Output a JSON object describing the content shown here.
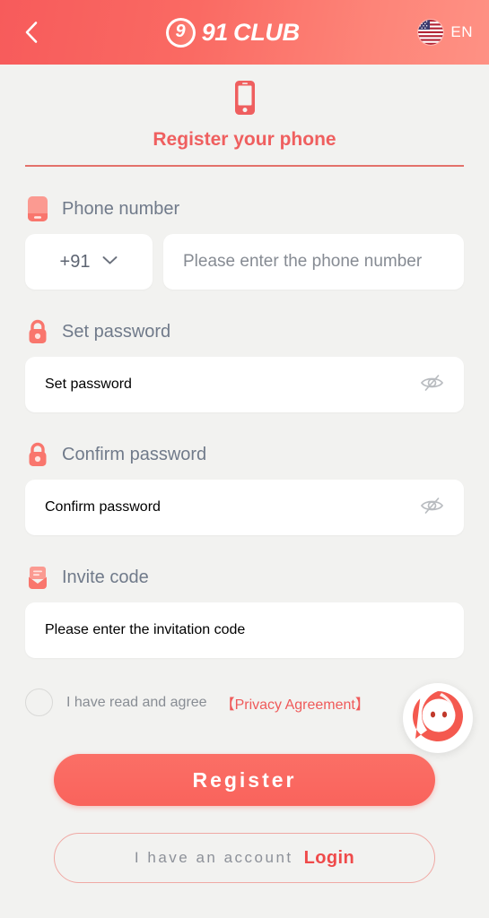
{
  "header": {
    "back_icon": "chevron-left-icon",
    "brand_mark_char": "9",
    "brand_name": "91",
    "brand_suffix": "CLUB",
    "flag_icon": "us-flag-icon",
    "language": "EN"
  },
  "title_section": {
    "icon": "mobile-phone-icon",
    "title": "Register your phone"
  },
  "form": {
    "phone": {
      "icon": "phone-icon",
      "label": "Phone number",
      "country_code": "+91",
      "dropdown_icon": "chevron-down-icon",
      "placeholder": "Please enter the phone number"
    },
    "password": {
      "icon": "lock-icon",
      "label": "Set password",
      "placeholder": "Set password",
      "toggle_icon": "eye-off-icon"
    },
    "confirm_password": {
      "icon": "lock-icon",
      "label": "Confirm password",
      "placeholder": "Confirm password",
      "toggle_icon": "eye-off-icon"
    },
    "invite": {
      "icon": "envelope-icon",
      "label": "Invite code",
      "placeholder": "Please enter the invitation code"
    }
  },
  "agreement": {
    "checked": false,
    "text": "I have read and agree",
    "link": "【Privacy Agreement】"
  },
  "support": {
    "icon": "chat-support-icon"
  },
  "actions": {
    "register": "Register",
    "login_lead": "I have an account",
    "login_link": "Login"
  },
  "colors": {
    "accent": "#ef5a5a",
    "header_gradient_start": "#f75b5b",
    "header_gradient_end": "#fe9184",
    "background": "#f2f2f0",
    "label_text": "#707a8a",
    "placeholder_text": "#868b93"
  }
}
